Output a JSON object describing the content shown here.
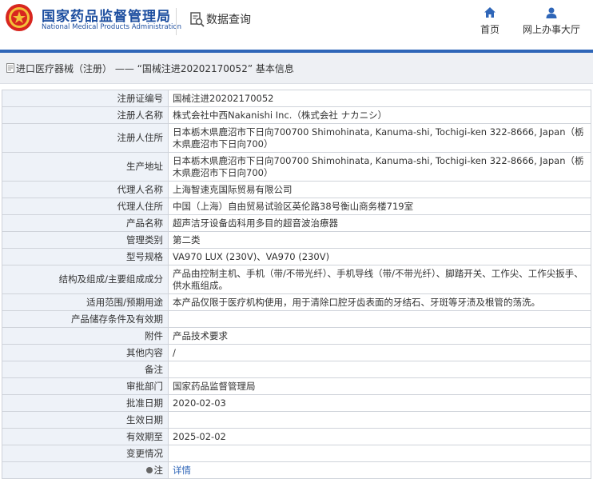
{
  "header": {
    "brand_cn": "国家药品监督管理局",
    "brand_en": "National Medical Products Administration",
    "query_title": "数据查询",
    "nav": [
      {
        "label": "首页",
        "icon": "home-icon"
      },
      {
        "label": "网上办事大厅",
        "icon": "user-icon"
      }
    ],
    "brand_color": "#1e4fa0",
    "accent_color": "#2f66b8"
  },
  "page_title": "进口医疗器械（注册） —— “国械注进20202170052” 基本信息",
  "rows": [
    {
      "label": "注册证编号",
      "value": "国械注进20202170052"
    },
    {
      "label": "注册人名称",
      "value": "株式会社中西Nakanishi Inc.（株式会社 ナカニシ）"
    },
    {
      "label": "注册人住所",
      "value": "日本栃木県鹿沼市下日向700700 Shimohinata, Kanuma-shi, Tochigi-ken 322-8666, Japan（栃木県鹿沼市下日向700）"
    },
    {
      "label": "生产地址",
      "value": "日本栃木県鹿沼市下日向700700 Shimohinata, Kanuma-shi, Tochigi-ken 322-8666, Japan（栃木県鹿沼市下日向700）"
    },
    {
      "label": "代理人名称",
      "value": "上海智速克国际贸易有限公司"
    },
    {
      "label": "代理人住所",
      "value": "中国（上海）自由贸易试验区英伦路38号衡山商务楼719室"
    },
    {
      "label": "产品名称",
      "value": "超声洁牙设备齿科用多目的超音波治療器"
    },
    {
      "label": "管理类别",
      "value": "第二类"
    },
    {
      "label": "型号规格",
      "value": "VA970 LUX (230V)、VA970 (230V)"
    },
    {
      "label": "结构及组成/主要组成成分",
      "value": "产品由控制主机、手机（带/不带光纤）、手机导线（带/不带光纤）、脚踏开关、工作尖、工作尖扳手、供水瓶组成。"
    },
    {
      "label": "适用范围/预期用途",
      "value": "本产品仅限于医疗机构使用，用于清除口腔牙齿表面的牙结石、牙斑等牙渍及根管的荡洗。"
    },
    {
      "label": "产品储存条件及有效期",
      "value": ""
    },
    {
      "label": "附件",
      "value": "产品技术要求"
    },
    {
      "label": "其他内容",
      "value": "/"
    },
    {
      "label": "备注",
      "value": ""
    },
    {
      "label": "审批部门",
      "value": "国家药品监督管理局"
    },
    {
      "label": "批准日期",
      "value": "2020-02-03"
    },
    {
      "label": "生效日期",
      "value": ""
    },
    {
      "label": "有效期至",
      "value": "2025-02-02"
    },
    {
      "label": "变更情况",
      "value": ""
    }
  ],
  "note": {
    "label": "注",
    "link": "详情"
  }
}
